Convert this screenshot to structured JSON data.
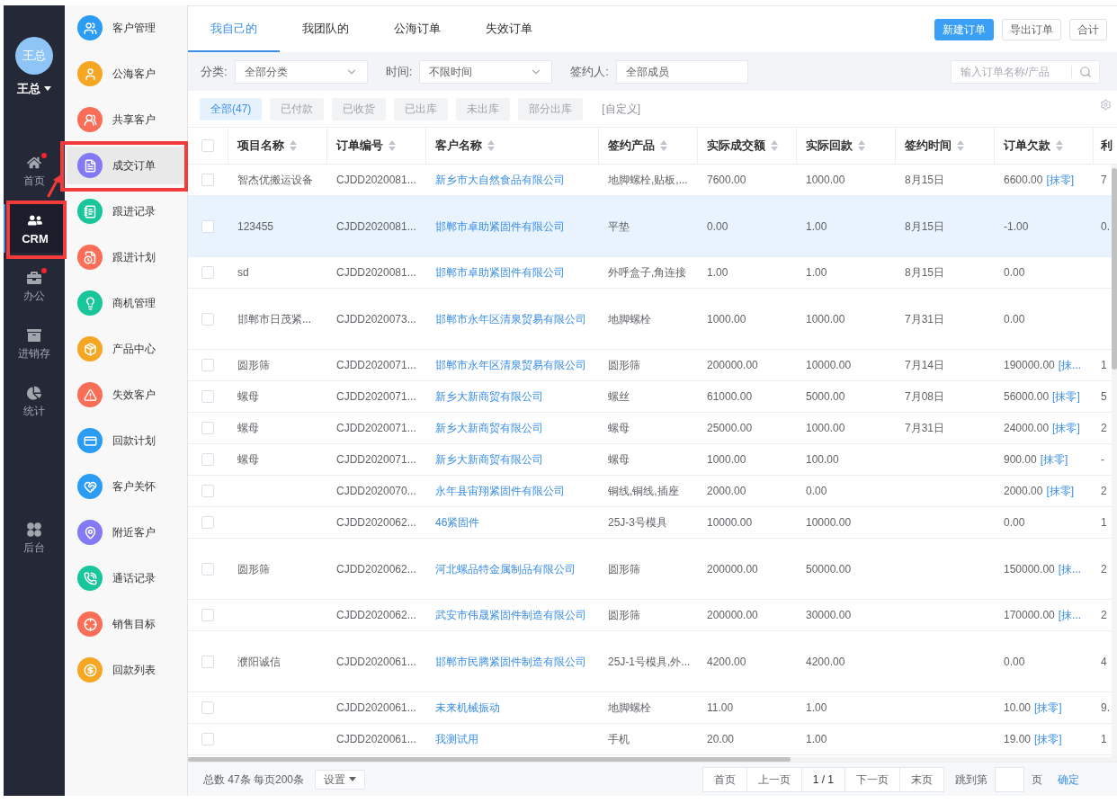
{
  "user": {
    "avatar_text": "王总",
    "name": "王总"
  },
  "nav": [
    {
      "label": "首页",
      "selected": false,
      "notification": true,
      "annotated": false
    },
    {
      "label": "CRM",
      "selected": true,
      "notification": false,
      "annotated": true
    },
    {
      "label": "办公",
      "selected": false,
      "notification": true,
      "annotated": false
    },
    {
      "label": "进销存",
      "selected": false,
      "notification": false,
      "annotated": false
    },
    {
      "label": "统计",
      "selected": false,
      "notification": false,
      "annotated": false
    },
    {
      "label": "后台",
      "selected": false,
      "notification": false,
      "annotated": false
    }
  ],
  "sidebar": {
    "items": [
      {
        "label": "客户管理",
        "color": "#2b9cf4",
        "selected": false,
        "annotated": false
      },
      {
        "label": "公海客户",
        "color": "#f5a623",
        "selected": false,
        "annotated": false
      },
      {
        "label": "共享客户",
        "color": "#fa6e57",
        "selected": false,
        "annotated": false
      },
      {
        "label": "成交订单",
        "color": "#8479f5",
        "selected": true,
        "annotated": true
      },
      {
        "label": "跟进记录",
        "color": "#19c59b",
        "selected": false,
        "annotated": false
      },
      {
        "label": "跟进计划",
        "color": "#fa6e57",
        "selected": false,
        "annotated": false
      },
      {
        "label": "商机管理",
        "color": "#19c59b",
        "selected": false,
        "annotated": false
      },
      {
        "label": "产品中心",
        "color": "#f5a623",
        "selected": false,
        "annotated": false
      },
      {
        "label": "失效客户",
        "color": "#fa6e57",
        "selected": false,
        "annotated": false
      },
      {
        "label": "回款计划",
        "color": "#2b9cf4",
        "selected": false,
        "annotated": false
      },
      {
        "label": "客户关怀",
        "color": "#2b9cf4",
        "selected": false,
        "annotated": false
      },
      {
        "label": "附近客户",
        "color": "#8479f5",
        "selected": false,
        "annotated": false
      },
      {
        "label": "通话记录",
        "color": "#19c59b",
        "selected": false,
        "annotated": false
      },
      {
        "label": "销售目标",
        "color": "#fa6e57",
        "selected": false,
        "annotated": false
      },
      {
        "label": "回款列表",
        "color": "#f5a623",
        "selected": false,
        "annotated": false
      }
    ]
  },
  "tabs": [
    {
      "label": "我自己的",
      "selected": true
    },
    {
      "label": "我团队的",
      "selected": false
    },
    {
      "label": "公海订单",
      "selected": false
    },
    {
      "label": "失效订单",
      "selected": false
    }
  ],
  "toolbar_buttons": [
    {
      "label": "新建订单",
      "kind": "primary"
    },
    {
      "label": "导出订单",
      "kind": "default"
    },
    {
      "label": "合计",
      "kind": "default"
    }
  ],
  "filters": [
    {
      "label": "分类:",
      "kind": "select",
      "value": "全部分类"
    },
    {
      "label": "时间:",
      "kind": "select",
      "value": "不限时间"
    },
    {
      "label": "签约人:",
      "kind": "input",
      "value": "全部成员"
    }
  ],
  "search": {
    "placeholder": "输入订单名称/产品"
  },
  "status_chips": [
    {
      "label": "全部(47)",
      "selected": true
    },
    {
      "label": "已付款",
      "selected": false
    },
    {
      "label": "已收货",
      "selected": false
    },
    {
      "label": "已出库",
      "selected": false
    },
    {
      "label": "未出库",
      "selected": false
    },
    {
      "label": "部分出库",
      "selected": false
    }
  ],
  "custom_link": "[自定义]",
  "table": {
    "header_checked": false,
    "columns": [
      {
        "label": "项目名称",
        "sortable": true
      },
      {
        "label": "订单编号",
        "sortable": true
      },
      {
        "label": "客户名称",
        "sortable": true
      },
      {
        "label": "签约产品",
        "sortable": true
      },
      {
        "label": "实际成交额",
        "sortable": true
      },
      {
        "label": "实际回款",
        "sortable": true
      },
      {
        "label": "签约时间",
        "sortable": true
      },
      {
        "label": "订单欠款",
        "sortable": true
      },
      {
        "label": "利",
        "sortable": false
      }
    ],
    "rows": [
      {
        "checked": false,
        "highlighted": false,
        "project": "智杰优搬运设备",
        "order_no": "CJDD2020081...",
        "customer": "新乡市大自然食品有限公司",
        "product": "地脚螺栓,贴板,...",
        "amount": "7600.00",
        "received": "1000.00",
        "signed_date": "8月15日",
        "debt": "6600.00",
        "debt_link": "[抹零]",
        "column_10": "7"
      },
      {
        "checked": false,
        "highlighted": true,
        "project": "123455",
        "order_no": "CJDD2020081...",
        "customer": "邯郸市卓助紧固件有限公司",
        "product": "平垫",
        "amount": "0.00",
        "received": "1.00",
        "signed_date": "8月15日",
        "debt": "-1.00",
        "column_10": "0."
      },
      {
        "checked": false,
        "highlighted": false,
        "project": "sd",
        "order_no": "CJDD2020081...",
        "customer": "邯郸市卓助紧固件有限公司",
        "product": "外呼盒子,角连接",
        "amount": "1.00",
        "received": "1.00",
        "signed_date": "8月15日",
        "debt": "0.00"
      },
      {
        "checked": false,
        "highlighted": false,
        "project": "邯郸市日茂紧...",
        "order_no": "CJDD2020073...",
        "customer": "邯郸市永年区清泉贸易有限公司",
        "product": "地脚螺栓",
        "amount": "1000.00",
        "received": "1000.00",
        "signed_date": "7月31日",
        "debt": "0.00"
      },
      {
        "checked": false,
        "highlighted": false,
        "project": "圆形筛",
        "order_no": "CJDD2020071...",
        "customer": "邯郸市永年区清泉贸易有限公司",
        "product": "圆形筛",
        "amount": "200000.00",
        "received": "10000.00",
        "signed_date": "7月14日",
        "debt": "190000.00",
        "debt_link": "[抹...",
        "column_10": "1"
      },
      {
        "checked": false,
        "highlighted": false,
        "project": "螺母",
        "order_no": "CJDD2020071...",
        "customer": "新乡大新商贸有限公司",
        "product": "螺丝",
        "amount": "61000.00",
        "received": "5000.00",
        "signed_date": "7月08日",
        "debt": "56000.00",
        "debt_link": "[抹零]",
        "column_10": "5"
      },
      {
        "checked": false,
        "highlighted": false,
        "project": "螺母",
        "order_no": "CJDD2020071...",
        "customer": "新乡大新商贸有限公司",
        "product": "螺母",
        "amount": "25000.00",
        "received": "1000.00",
        "signed_date": "7月31日",
        "debt": "24000.00",
        "debt_link": "[抹零]",
        "column_10": "2"
      },
      {
        "checked": false,
        "highlighted": false,
        "project": "螺母",
        "order_no": "CJDD2020071...",
        "customer": "新乡大新商贸有限公司",
        "product": "螺母",
        "amount": "1000.00",
        "received": "100.00",
        "debt": "900.00",
        "debt_link": "[抹零]",
        "column_10": "-"
      },
      {
        "checked": false,
        "highlighted": false,
        "order_no": "CJDD2020070...",
        "customer": "永年县宙翔紧固件有限公司",
        "product": "铜线,铜线,插座",
        "amount": "2000.00",
        "received": "0.00",
        "debt": "2000.00",
        "debt_link": "[抹零]",
        "column_10": "2"
      },
      {
        "checked": false,
        "highlighted": false,
        "order_no": "CJDD2020062...",
        "customer": "46紧固件",
        "product": "25J-3号模具",
        "amount": "10000.00",
        "received": "10000.00",
        "debt": "0.00",
        "column_10": "1"
      },
      {
        "checked": false,
        "highlighted": false,
        "project": "圆形筛",
        "order_no": "CJDD2020062...",
        "customer": "河北螺品特金属制品有限公司",
        "product": "圆形筛",
        "amount": "200000.00",
        "received": "50000.00",
        "debt": "150000.00",
        "debt_link": "[抹...",
        "column_10": "2"
      },
      {
        "checked": false,
        "highlighted": false,
        "order_no": "CJDD2020062...",
        "customer": "武安市伟晟紧固件制造有限公司",
        "product": "圆形筛",
        "amount": "200000.00",
        "received": "30000.00",
        "debt": "170000.00",
        "debt_link": "[抹...",
        "column_10": "2"
      },
      {
        "checked": false,
        "highlighted": false,
        "project": "濮阳诚信",
        "order_no": "CJDD2020061...",
        "customer": "邯郸市民腾紧固件制造有限公司",
        "product": "25J-1号模具,外...",
        "amount": "4200.00",
        "received": "4200.00",
        "debt": "0.00",
        "column_10": "4"
      },
      {
        "checked": false,
        "highlighted": false,
        "order_no": "CJDD2020061...",
        "customer": "未来机械振动",
        "product": "地脚螺栓",
        "amount": "11.00",
        "received": "1.00",
        "debt": "10.00",
        "debt_link": "[抹零]",
        "column_10": "9."
      },
      {
        "checked": false,
        "highlighted": false,
        "order_no": "CJDD2020061...",
        "customer": "我测试用",
        "product": "手机",
        "amount": "20.00",
        "received": "1.00",
        "debt": "19.00",
        "debt_link": "[抹零]",
        "column_10": "1"
      }
    ]
  },
  "footer": {
    "summary": "总数 47条 每页200条",
    "settings": "设置",
    "pagination": [
      {
        "label": "首页",
        "kind": "button"
      },
      {
        "label": "上一页",
        "kind": "button"
      },
      {
        "label": "1 / 1",
        "kind": "indicator"
      },
      {
        "label": "下一页",
        "kind": "button"
      },
      {
        "label": "末页",
        "kind": "button"
      }
    ],
    "jump_label": "跳到第",
    "jump_suffix": "页",
    "confirm": "确定"
  }
}
